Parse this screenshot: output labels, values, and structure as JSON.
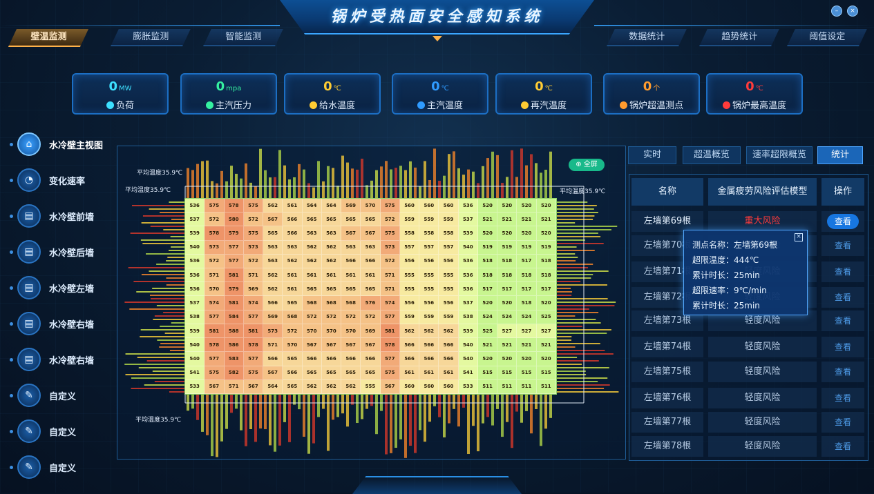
{
  "app": {
    "title": "锅炉受热面安全感知系统"
  },
  "nav_tabs": [
    {
      "label": "壁温监测",
      "active": true
    },
    {
      "label": "膨胀监测"
    },
    {
      "label": "智能监测"
    },
    {
      "label": "数据统计"
    },
    {
      "label": "趋势统计"
    },
    {
      "label": "阈值设定"
    }
  ],
  "metrics": [
    {
      "value": "0",
      "unit": "MW",
      "label": "负荷",
      "color": "#3de0ff",
      "icon": "gauge-icon"
    },
    {
      "value": "0",
      "unit": "mpa",
      "label": "主汽压力",
      "color": "#35f0a0",
      "icon": "pressure-icon"
    },
    {
      "value": "0",
      "unit": "℃",
      "label": "给水温度",
      "color": "#ffcc33",
      "icon": "thermometer-icon"
    },
    {
      "value": "0",
      "unit": "℃",
      "label": "主汽温度",
      "color": "#2f9bff",
      "icon": "thermometer-icon"
    },
    {
      "value": "0",
      "unit": "℃",
      "label": "再汽温度",
      "color": "#ffcc33",
      "icon": "thermometer-icon"
    },
    {
      "value": "0",
      "unit": "个",
      "label": "锅炉超温测点",
      "color": "#ff9b2e",
      "icon": "alarm-icon"
    },
    {
      "value": "0",
      "unit": "℃",
      "label": "锅炉最高温度",
      "color": "#ff3b3b",
      "icon": "fire-icon"
    }
  ],
  "left_nav": [
    {
      "label": "水冷壁主视图",
      "icon": "home-icon",
      "active": true
    },
    {
      "label": "变化速率",
      "icon": "rate-icon"
    },
    {
      "label": "水冷壁前墙",
      "icon": "wall-icon"
    },
    {
      "label": "水冷壁后墙",
      "icon": "wall-icon"
    },
    {
      "label": "水冷壁左墙",
      "icon": "wall-icon"
    },
    {
      "label": "水冷壁右墙",
      "icon": "wall-icon"
    },
    {
      "label": "水冷壁右墙",
      "icon": "wall-icon"
    },
    {
      "label": "自定义",
      "icon": "edit-icon"
    },
    {
      "label": "自定义",
      "icon": "edit-icon"
    },
    {
      "label": "自定义",
      "icon": "edit-icon"
    }
  ],
  "heatmap": {
    "fullscreen_label": "全屏",
    "avg_top": "平均温度35.9℃",
    "avg_left": "平均温度35.9℃",
    "avg_right": "平均温度35.9℃",
    "avg_bottom": "平均温度35.9℃",
    "rows": [
      [
        536,
        575,
        578,
        575,
        562,
        561,
        564,
        564,
        569,
        570,
        575,
        560,
        560,
        560,
        536,
        520,
        520,
        520,
        520
      ],
      [
        537,
        572,
        580,
        572,
        567,
        566,
        565,
        565,
        565,
        565,
        572,
        559,
        559,
        559,
        537,
        521,
        521,
        521,
        521
      ],
      [
        539,
        578,
        579,
        575,
        565,
        566,
        563,
        563,
        567,
        567,
        575,
        558,
        558,
        558,
        539,
        520,
        520,
        520,
        520
      ],
      [
        540,
        573,
        577,
        573,
        563,
        563,
        562,
        562,
        563,
        563,
        573,
        557,
        557,
        557,
        540,
        519,
        519,
        519,
        519
      ],
      [
        536,
        572,
        577,
        572,
        563,
        562,
        562,
        562,
        566,
        566,
        572,
        556,
        556,
        556,
        536,
        518,
        518,
        517,
        518
      ],
      [
        536,
        571,
        581,
        571,
        562,
        561,
        561,
        561,
        561,
        561,
        571,
        555,
        555,
        555,
        536,
        518,
        518,
        518,
        518
      ],
      [
        536,
        570,
        579,
        569,
        562,
        561,
        565,
        565,
        565,
        565,
        571,
        555,
        555,
        555,
        536,
        517,
        517,
        517,
        517
      ],
      [
        537,
        574,
        581,
        574,
        566,
        565,
        568,
        568,
        568,
        576,
        574,
        556,
        556,
        556,
        537,
        520,
        520,
        518,
        520
      ],
      [
        538,
        577,
        584,
        577,
        569,
        568,
        572,
        572,
        572,
        572,
        577,
        559,
        559,
        559,
        538,
        524,
        524,
        524,
        525
      ],
      [
        539,
        581,
        588,
        581,
        573,
        572,
        570,
        570,
        570,
        569,
        581,
        562,
        562,
        562,
        539,
        525,
        527,
        527,
        527
      ],
      [
        540,
        578,
        586,
        578,
        571,
        570,
        567,
        567,
        567,
        567,
        578,
        566,
        566,
        566,
        540,
        521,
        521,
        521,
        521
      ],
      [
        540,
        577,
        583,
        577,
        566,
        565,
        566,
        566,
        566,
        566,
        577,
        566,
        566,
        566,
        540,
        520,
        520,
        520,
        520
      ],
      [
        541,
        575,
        582,
        575,
        567,
        566,
        565,
        565,
        565,
        565,
        575,
        561,
        561,
        561,
        541,
        515,
        515,
        515,
        515
      ],
      [
        533,
        567,
        571,
        567,
        564,
        565,
        562,
        562,
        562,
        555,
        567,
        560,
        560,
        560,
        533,
        511,
        511,
        511,
        511
      ]
    ]
  },
  "right_tabs": [
    {
      "label": "实时"
    },
    {
      "label": "超温概览"
    },
    {
      "label": "速率超限概览"
    },
    {
      "label": "统计",
      "active": true
    }
  ],
  "table": {
    "headers": [
      "名称",
      "金属疲劳风险评估模型",
      "操作"
    ],
    "rows": [
      {
        "name": "左墙第69根",
        "risk": "重大风险",
        "action": "查看",
        "danger": true
      },
      {
        "name": "左墙第70根",
        "risk": "轻度风险",
        "action": "查看"
      },
      {
        "name": "左墙第71根",
        "risk": "轻度风险",
        "action": "查看"
      },
      {
        "name": "左墙第72根",
        "risk": "轻度风险",
        "action": "查看"
      },
      {
        "name": "左墙第73根",
        "risk": "轻度风险",
        "action": "查看"
      },
      {
        "name": "左墙第74根",
        "risk": "轻度风险",
        "action": "查看"
      },
      {
        "name": "左墙第75根",
        "risk": "轻度风险",
        "action": "查看"
      },
      {
        "name": "左墙第76根",
        "risk": "轻度风险",
        "action": "查看"
      },
      {
        "name": "左墙第77根",
        "risk": "轻度风险",
        "action": "查看"
      },
      {
        "name": "左墙第78根",
        "risk": "轻度风险",
        "action": "查看"
      }
    ]
  },
  "popup": {
    "lines": [
      "测点名称：左墙第69根",
      "超限温度：444℃",
      "累计时长：25min",
      "超限速率：9℃/min",
      "累计时长：25min"
    ],
    "close": "×"
  }
}
